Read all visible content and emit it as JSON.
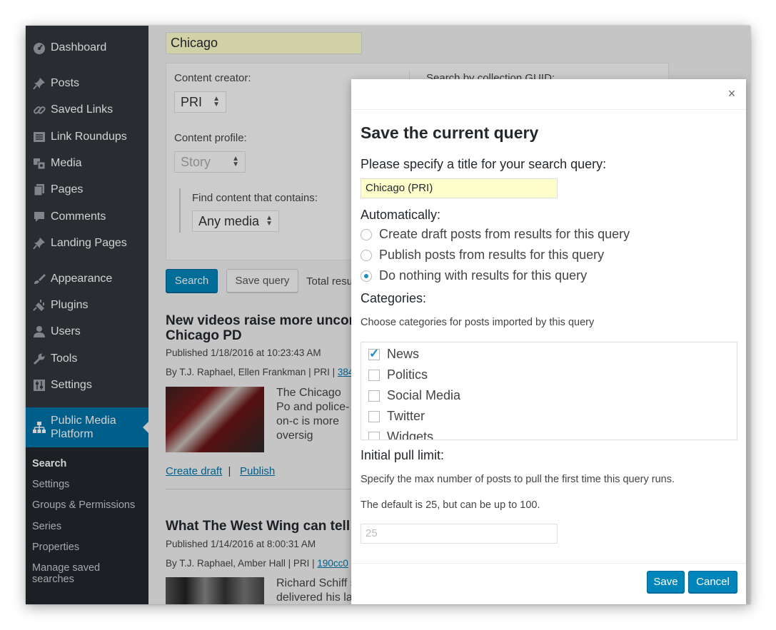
{
  "sidebar": {
    "items": [
      {
        "label": "Dashboard",
        "icon": "dashboard-icon"
      },
      {
        "label": "Posts",
        "icon": "pin-icon"
      },
      {
        "label": "Saved Links",
        "icon": "link-icon"
      },
      {
        "label": "Link Roundups",
        "icon": "list-icon"
      },
      {
        "label": "Media",
        "icon": "media-icon"
      },
      {
        "label": "Pages",
        "icon": "pages-icon"
      },
      {
        "label": "Comments",
        "icon": "comment-icon"
      },
      {
        "label": "Landing Pages",
        "icon": "pin-icon"
      },
      {
        "label": "Appearance",
        "icon": "brush-icon"
      },
      {
        "label": "Plugins",
        "icon": "plug-icon"
      },
      {
        "label": "Users",
        "icon": "user-icon"
      },
      {
        "label": "Tools",
        "icon": "wrench-icon"
      },
      {
        "label": "Settings",
        "icon": "sliders-icon"
      },
      {
        "label": "Public Media Platform",
        "icon": "network-icon"
      }
    ],
    "submenu": [
      "Search",
      "Settings",
      "Groups & Permissions",
      "Series",
      "Properties",
      "Manage saved searches"
    ]
  },
  "search": {
    "value": "Chicago",
    "content_creator_label": "Content creator:",
    "content_creator_value": "PRI",
    "content_profile_label": "Content profile:",
    "content_profile_value": "Story",
    "contains_label": "Find content that contains:",
    "contains_value": "Any media",
    "guid_label": "Search by collection GUID:",
    "search_button": "Search",
    "save_query_button": "Save query",
    "total_results": "Total resu"
  },
  "results": [
    {
      "title": "New videos raise more uncor Chicago PD",
      "published": "Published 1/18/2016 at 10:23:43 AM",
      "byline": "By T.J. Raphael, Ellen Frankman | PRI | ",
      "guid": "384",
      "excerpt": "The Chicago Po and police-on-c is more oversig",
      "create_draft": "Create draft",
      "publish": "Publish"
    },
    {
      "title": "What The West Wing can tell",
      "published": "Published 1/14/2016 at 8:00:31 AM",
      "byline": "By T.J. Raphael, Amber Hall | PRI | ",
      "guid": "190cc0",
      "excerpt": "Richard Schiff s writer for President Jed Bartlett. The day after President Obama delivered his last"
    }
  ],
  "modal": {
    "close": "×",
    "title": "Save the current query",
    "title_prompt": "Please specify a title for your search query:",
    "title_value": "Chicago (PRI)",
    "automatically_label": "Automatically:",
    "options": [
      {
        "label": "Create draft posts from results for this query",
        "selected": false
      },
      {
        "label": "Publish posts from results for this query",
        "selected": false
      },
      {
        "label": "Do nothing with results for this query",
        "selected": true
      }
    ],
    "categories_label": "Categories:",
    "categories_help": "Choose categories for posts imported by this query",
    "categories": [
      {
        "label": "News",
        "checked": true
      },
      {
        "label": "Politics",
        "checked": false
      },
      {
        "label": "Social Media",
        "checked": false
      },
      {
        "label": "Twitter",
        "checked": false
      },
      {
        "label": "Widgets",
        "checked": false
      }
    ],
    "pull_limit_label": "Initial pull limit:",
    "pull_limit_help1": "Specify the max number of posts to pull the first time this query runs.",
    "pull_limit_help2": "The default is 25, but can be up to 100.",
    "pull_limit_placeholder": "25",
    "save_button": "Save",
    "cancel_button": "Cancel"
  },
  "colors": {
    "accent": "#0085ba",
    "sidebar": "#32373c",
    "active": "#0073aa",
    "highlight": "#ffffcc"
  }
}
